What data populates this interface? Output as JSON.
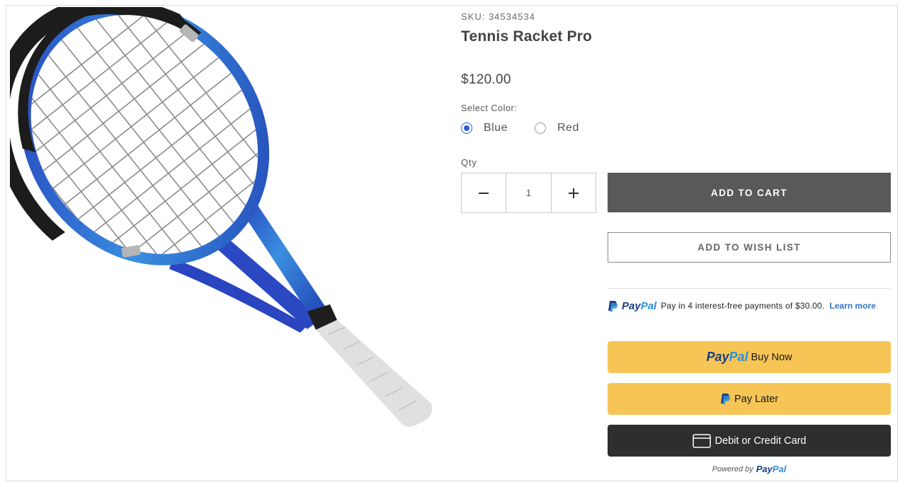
{
  "product": {
    "sku": "SKU: 34534534",
    "title": "Tennis Racket Pro",
    "price": "$120.00",
    "image_alt": "tennis racket",
    "colors": {
      "accent_blue": "#2b5fd9",
      "racket_blue": "#2f4fc4",
      "grip": "#e0e0e0"
    }
  },
  "options": {
    "color_label": "Select Color:",
    "choices": [
      {
        "label": "Blue",
        "selected": true
      },
      {
        "label": "Red",
        "selected": false
      }
    ]
  },
  "quantity": {
    "label": "Qty",
    "value": "1",
    "decrement_icon": "minus-icon",
    "increment_icon": "plus-icon"
  },
  "actions": {
    "add_to_cart": "ADD TO CART",
    "add_to_wish_list": "ADD TO WISH LIST"
  },
  "paypal": {
    "logo_pay": "Pay",
    "logo_pal": "Pal",
    "message": "Pay in 4 interest-free payments of $30.00.",
    "learn_more": "Learn more",
    "buy_now_label": "Buy Now",
    "pay_later_label": "Pay Later",
    "card_label": "Debit or Credit Card",
    "powered_by": "Powered by",
    "colors": {
      "button_gold": "#f6c556",
      "card_black": "#2c2e2f",
      "dark_blue": "#1b3d82",
      "light_blue": "#2d8fd6"
    }
  }
}
